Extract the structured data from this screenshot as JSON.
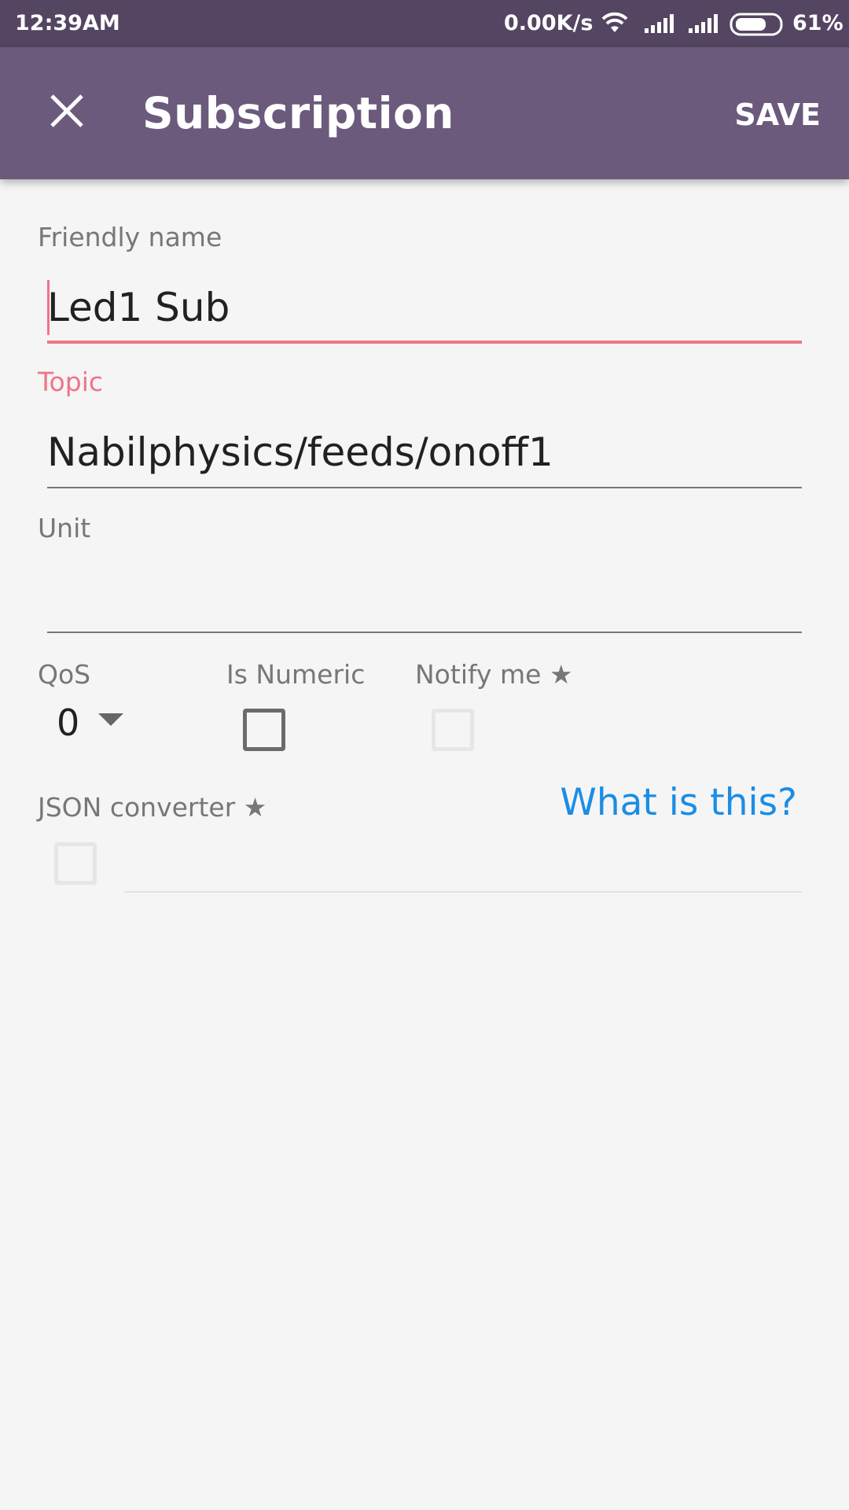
{
  "status_bar": {
    "time": "12:39AM",
    "net_speed": "0.00K/s",
    "battery": "61%",
    "icons": [
      "wifi-icon",
      "signal-icon",
      "signal-icon",
      "battery-icon"
    ]
  },
  "app_bar": {
    "title": "Subscription",
    "save_label": "SAVE",
    "close_icon": "close-icon",
    "background": "#6b5a7b"
  },
  "form": {
    "friendly_name": {
      "label": "Friendly name",
      "value": "Led1 Sub"
    },
    "topic": {
      "label": "Topic",
      "value": "Nabilphysics/feeds/onoff1"
    },
    "unit": {
      "label": "Unit",
      "value": ""
    },
    "qos": {
      "label": "QoS",
      "value": "0"
    },
    "is_numeric": {
      "label": "Is Numeric",
      "checked": false
    },
    "notify_me": {
      "label": "Notify me ★",
      "checked": false,
      "enabled": false
    },
    "json_converter": {
      "label": "JSON converter ★",
      "checked": false,
      "enabled": false
    },
    "what_is_this": "What is this?"
  },
  "colors": {
    "status_bar": "#544562",
    "accent": "#ee7588",
    "link": "#1a8de6",
    "background": "#f5f5f5"
  }
}
